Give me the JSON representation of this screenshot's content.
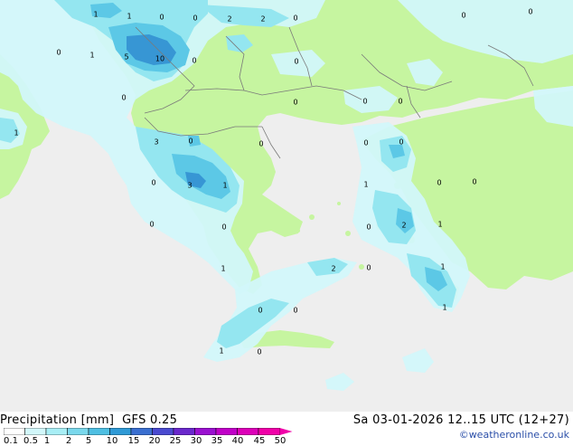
{
  "title": "Precipitation [mm]",
  "model": "GFS 0.25",
  "valid_time": "Sa 03-01-2026 12..15 UTC (12+27)",
  "credit": "©weatheronline.co.uk",
  "colors": {
    "sea": "#eeeeee",
    "land": "#c6f5a0",
    "precip_light": "#d2f7fa",
    "precip_mid": "#94e6f0",
    "precip_heavy": "#5cc8e6",
    "precip_max": "#3796d4"
  },
  "legend": {
    "labels": [
      "0.1",
      "0.5",
      "1",
      "2",
      "5",
      "10",
      "15",
      "20",
      "25",
      "30",
      "35",
      "40",
      "45",
      "50"
    ],
    "colors": [
      "#ffffff",
      "#d2f7fa",
      "#a8eef5",
      "#7ad8ec",
      "#4ebfe2",
      "#2f9ad6",
      "#3a6fd0",
      "#4a4ad0",
      "#6a28cc",
      "#9a10d0",
      "#c000c8",
      "#dc00b8",
      "#f000a8"
    ]
  },
  "map_labels": [
    {
      "id": "n1",
      "v": "1"
    },
    {
      "id": "n2",
      "v": "1"
    },
    {
      "id": "n3",
      "v": "0"
    },
    {
      "id": "n4",
      "v": "0"
    },
    {
      "id": "n5",
      "v": "2"
    },
    {
      "id": "n6",
      "v": "2"
    },
    {
      "id": "n7",
      "v": "0"
    },
    {
      "id": "n8",
      "v": "0"
    },
    {
      "id": "n9",
      "v": "0"
    },
    {
      "id": "n10",
      "v": "0"
    },
    {
      "id": "n11",
      "v": "1"
    },
    {
      "id": "n12",
      "v": "5"
    },
    {
      "id": "n13",
      "v": "10"
    },
    {
      "id": "n14",
      "v": "0"
    },
    {
      "id": "n15",
      "v": "0"
    },
    {
      "id": "n16",
      "v": "0"
    },
    {
      "id": "n17",
      "v": "1"
    },
    {
      "id": "n18",
      "v": "0"
    },
    {
      "id": "n19",
      "v": "0"
    },
    {
      "id": "n20",
      "v": "0"
    },
    {
      "id": "n21",
      "v": "3"
    },
    {
      "id": "n22",
      "v": "0"
    },
    {
      "id": "n23",
      "v": "0"
    },
    {
      "id": "n24",
      "v": "0"
    },
    {
      "id": "n25",
      "v": "0"
    },
    {
      "id": "n26",
      "v": "0"
    },
    {
      "id": "n27",
      "v": "3"
    },
    {
      "id": "n28",
      "v": "1"
    },
    {
      "id": "n29",
      "v": "1"
    },
    {
      "id": "n30",
      "v": "0"
    },
    {
      "id": "n31",
      "v": "0"
    },
    {
      "id": "n32",
      "v": "0"
    },
    {
      "id": "n33",
      "v": "0"
    },
    {
      "id": "n34",
      "v": "0"
    },
    {
      "id": "n35",
      "v": "2"
    },
    {
      "id": "n36",
      "v": "1"
    },
    {
      "id": "n37",
      "v": "1"
    },
    {
      "id": "n38",
      "v": "2"
    },
    {
      "id": "n39",
      "v": "0"
    },
    {
      "id": "n40",
      "v": "1"
    },
    {
      "id": "n41",
      "v": "1"
    },
    {
      "id": "n42",
      "v": "0"
    },
    {
      "id": "n43",
      "v": "0"
    },
    {
      "id": "n44",
      "v": "1"
    },
    {
      "id": "n45",
      "v": "0"
    }
  ]
}
